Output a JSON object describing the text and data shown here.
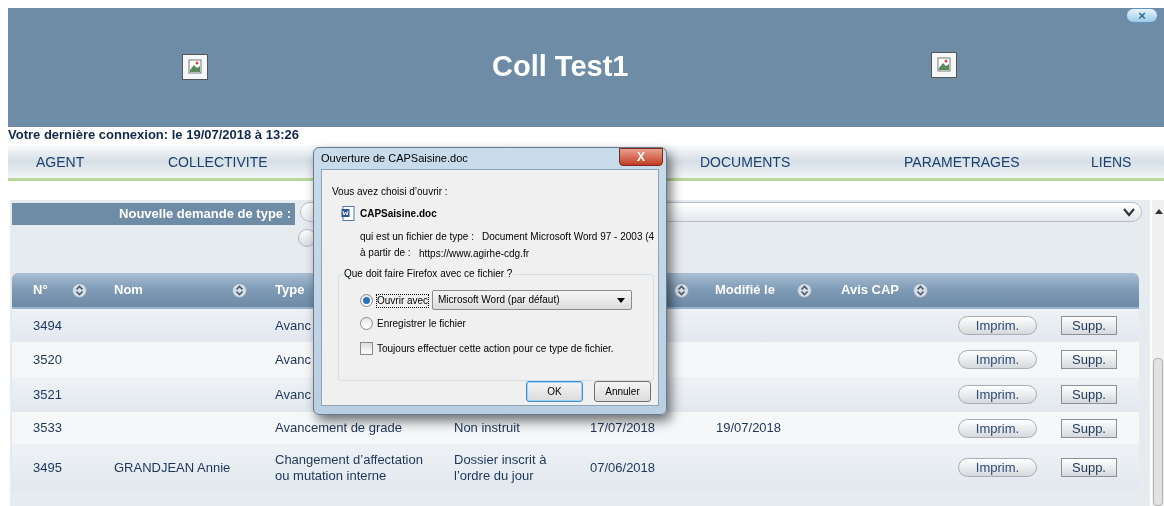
{
  "header": {
    "title": "Coll Test1",
    "close_label": "×"
  },
  "last_login": "Votre dernière connexion: le 19/07/2018 à 13:26",
  "nav": [
    {
      "label": "AGENT"
    },
    {
      "label": "COLLECTIVITE"
    },
    {
      "label": "DOCUMENTS"
    },
    {
      "label": "PARAMETRAGES"
    },
    {
      "label": "LIENS"
    }
  ],
  "new_request": {
    "label": "Nouvelle demande de type :",
    "radio_selected": false
  },
  "table": {
    "columns": [
      "N°",
      "Nom",
      "Type",
      "Modifié le",
      "Avis CAP"
    ],
    "rows": [
      {
        "number": "3494",
        "name": "",
        "type": "Avanc",
        "status": "",
        "created": "",
        "modified": "",
        "print": "Imprim.",
        "delete": "Supp."
      },
      {
        "number": "3520",
        "name": "",
        "type": "Avanc",
        "status": "",
        "created": "",
        "modified": "",
        "print": "Imprim.",
        "delete": "Supp."
      },
      {
        "number": "3521",
        "name": "",
        "type": "Avanc",
        "status": "",
        "created": "",
        "modified": "",
        "print": "Imprim.",
        "delete": "Supp."
      },
      {
        "number": "3533",
        "name": "",
        "type": "Avancement de grade",
        "status": "Non instruit",
        "created": "17/07/2018",
        "modified": "19/07/2018",
        "print": "Imprim.",
        "delete": "Supp."
      },
      {
        "number": "3495",
        "name": "GRANDJEAN Annie",
        "type": "Changement d’affectation ou mutation interne",
        "status": "Dossier inscrit à l’ordre du jour",
        "created": "07/06/2018",
        "modified": "",
        "print": "Imprim.",
        "delete": "Supp."
      }
    ]
  },
  "dialog": {
    "title": "Ouverture de CAPSaisine.doc",
    "close_label": "X",
    "intro": "Vous avez choisi d’ouvrir :",
    "filename": "CAPSaisine.doc",
    "type_label": "qui est un fichier de type :",
    "type_value": "Document Microsoft Word 97 - 2003 (4",
    "from_label": "à partir de :",
    "from_value": "https://www.agirhe-cdg.fr",
    "group_label": "Que doit faire Firefox avec ce fichier ?",
    "options": [
      {
        "label": "Ouvrir avec",
        "selected": true
      },
      {
        "label": "Enregistrer le fichier",
        "selected": false
      }
    ],
    "app": "Microsoft Word (par défaut)",
    "always": {
      "label": "Toujours effectuer cette action pour ce type de fichier.",
      "checked": false
    },
    "buttons": [
      {
        "label": "OK",
        "default": true
      },
      {
        "label": "Annuler",
        "default": false
      }
    ]
  }
}
